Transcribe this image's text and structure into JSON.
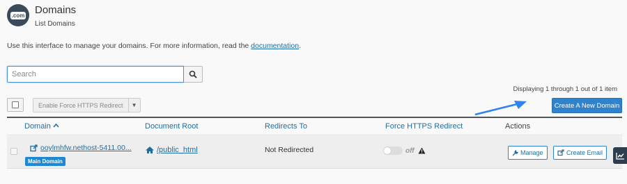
{
  "header": {
    "logo_text": ".com",
    "title": "Domains",
    "subtitle": "List Domains"
  },
  "intro": {
    "text": "Use this interface to manage your domains. For more information, read the ",
    "link": "documentation",
    "suffix": "."
  },
  "search": {
    "value": "",
    "placeholder": "Search",
    "button_icon": "search-icon"
  },
  "toolbar": {
    "display_count": "Displaying 1 through 1 out of 1 item",
    "bulk_action_label": "Enable Force HTTPS Redirect",
    "create_label": "Create A New Domain"
  },
  "table": {
    "columns": [
      "Domain",
      "Document Root",
      "Redirects To",
      "Force HTTPS Redirect",
      "Actions"
    ],
    "sorted_column": "Domain",
    "rows": [
      {
        "domain": "ooylmhfw.nethost-5411.00...",
        "badge": "Main Domain",
        "document_root": "/public_html",
        "redirects_to": "Not Redirected",
        "force_https": "off",
        "actions": [
          "Manage",
          "Create Email"
        ]
      }
    ]
  },
  "colors": {
    "primary": "#2f82cc",
    "link": "#1f6ea3",
    "badge": "#1f88d0",
    "header_logo": "#3b4a5a"
  }
}
